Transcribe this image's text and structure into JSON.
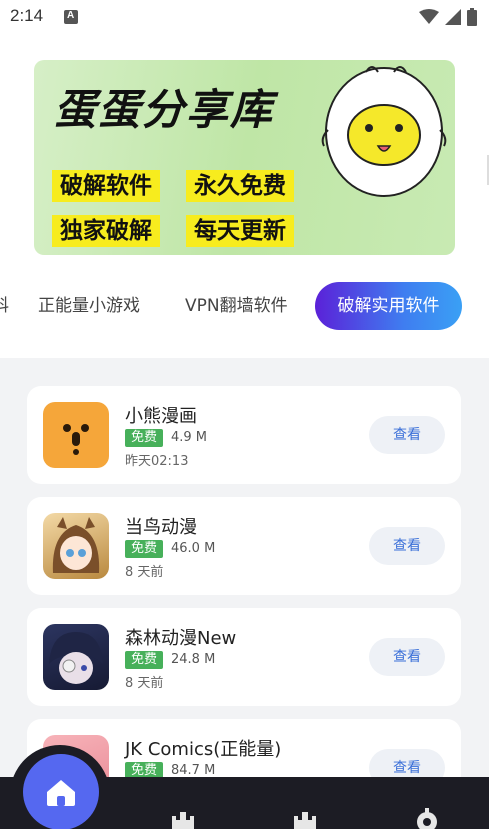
{
  "status_bar": {
    "time": "2:14"
  },
  "banner": {
    "title": "蛋蛋分享库",
    "tags": [
      "破解软件",
      "永久免费",
      "独家破解",
      "每天更新"
    ]
  },
  "tabs": {
    "partial_label": "科",
    "items": [
      "正能量小游戏",
      "VPN翻墙软件",
      "破解实用软件"
    ],
    "active_index": 2
  },
  "apps": [
    {
      "name": "小熊漫画",
      "badge": "免费",
      "size": "4.9 M",
      "time": "昨天02:13",
      "button": "查看"
    },
    {
      "name": "当鸟动漫",
      "badge": "免费",
      "size": "46.0 M",
      "time": "8 天前",
      "button": "查看"
    },
    {
      "name": "森林动漫New",
      "badge": "免费",
      "size": "24.8 M",
      "time": "8 天前",
      "button": "查看"
    },
    {
      "name": "JK Comics(正能量)",
      "badge": "免费",
      "size": "84.7 M",
      "time": "",
      "button": "查看"
    }
  ],
  "colors": {
    "accent_gradient_start": "#5b21d8",
    "accent_gradient_end": "#3aa0f5",
    "free_badge": "#47b05a",
    "nav_bg": "#1c1c24",
    "home_button": "#5568f0"
  },
  "bottom_nav": {
    "icons": [
      "home-icon",
      "castle-icon",
      "castle-icon",
      "gear-icon"
    ],
    "active_index": 0
  }
}
